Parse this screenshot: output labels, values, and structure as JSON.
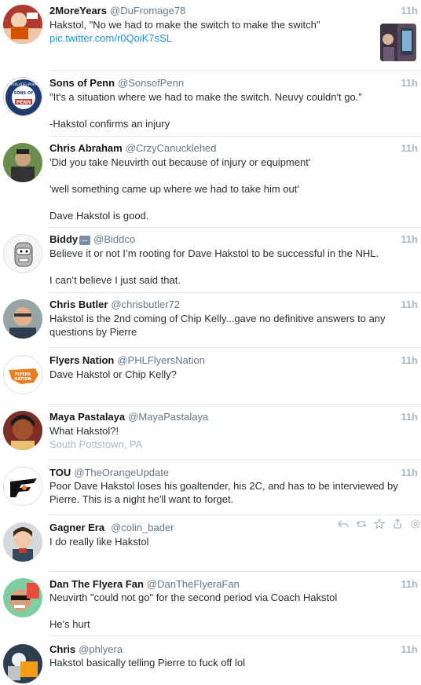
{
  "colors": {
    "name": "#14171a",
    "handle": "#657786",
    "time": "#aab8c2",
    "link": "#1b95e0",
    "separator": "#e1e8ed"
  },
  "tweets": [
    {
      "name": "2MoreYears",
      "handle": "@DuFromage78",
      "time": "11h",
      "lines": [
        "Hakstol, \"No we had to make the switch to make the switch\""
      ],
      "link": "pic.twitter.com/r0QoiK7sSL",
      "avatar_icon": "hockey-player-avatar",
      "media_icon": "photo-thumbnail"
    },
    {
      "name": "Sons of Penn",
      "handle": "@SonsofPenn",
      "time": "11h",
      "lines": [
        "\"It's a situation where we had to make the switch. Neuvy couldn't go.\"",
        "",
        "-Hakstol confirms an injury"
      ],
      "avatar_icon": "sons-of-penn-logo",
      "avatar_text": [
        "PHILADELPHIA",
        "SONS OF",
        "PENN"
      ]
    },
    {
      "name": "Chris Abraham",
      "handle": "@CrzyCanucklehed",
      "time": "11h",
      "lines": [
        "'Did you take Neuvirth out because of injury or equipment'",
        "",
        "'well something came up where we had to take him out'",
        "",
        "Dave Hakstol is good."
      ],
      "avatar_icon": "person-avatar"
    },
    {
      "name": "Biddy",
      "badge": "↔",
      "handle": "@Biddco",
      "time": "11h",
      "lines": [
        "Believe it or not I’m rooting for Dave Hakstol to be successful in the NHL.",
        "",
        "I can’t believe I just said that."
      ],
      "avatar_icon": "robot-cartoon-avatar"
    },
    {
      "name": "Chris Butler",
      "handle": "@chrisbutler72",
      "time": "11h",
      "lines": [
        "Hakstol is the 2nd coming of Chip Kelly...gave no definitive answers to any",
        "questions by Pierre"
      ],
      "avatar_icon": "person-avatar"
    },
    {
      "name": "Flyers Nation",
      "handle": "@PHLFlyersNation",
      "time": "11h",
      "lines": [
        "Dave Hakstol or Chip Kelly?"
      ],
      "avatar_icon": "flyers-nation-logo",
      "avatar_text": [
        "FLYERS",
        "NATION"
      ]
    },
    {
      "name": "Maya Pastalaya",
      "handle": "@MayaPastalaya",
      "time": "11h",
      "lines": [
        "What Hakstol?!"
      ],
      "location": "South Pottstown, PA",
      "avatar_icon": "person-avatar"
    },
    {
      "name": "TOU",
      "handle": "@TheOrangeUpdate",
      "time": "11h",
      "lines": [
        "Poor Dave Hakstol loses his goaltender, his 2C, and has to be interviewed by",
        "Pierre. This is a night he'll want to forget."
      ],
      "avatar_icon": "flyers-logo-avatar"
    },
    {
      "name": "Gagner Era",
      "handle": "@colin_bader",
      "lines": [
        "I do really like Hakstol"
      ],
      "avatar_icon": "cartoon-avatar",
      "actions": [
        "reply-icon",
        "retweet-icon",
        "like-icon",
        "share-icon",
        "settings-icon"
      ]
    },
    {
      "name": "Dan The Flyera Fan",
      "handle": "@DanTheFlyeraFan",
      "time": "11h",
      "lines": [
        "Neuvirth \"could not go\" for the second period via Coach Hakstol",
        "",
        "He's hurt"
      ],
      "avatar_icon": "face-avatar"
    },
    {
      "name": "Chris",
      "handle": "@phlyera",
      "time": "11h",
      "lines": [
        "Hakstol basically telling Pierre to fuck off lol"
      ],
      "avatar_icon": "hockey-player-avatar"
    }
  ]
}
